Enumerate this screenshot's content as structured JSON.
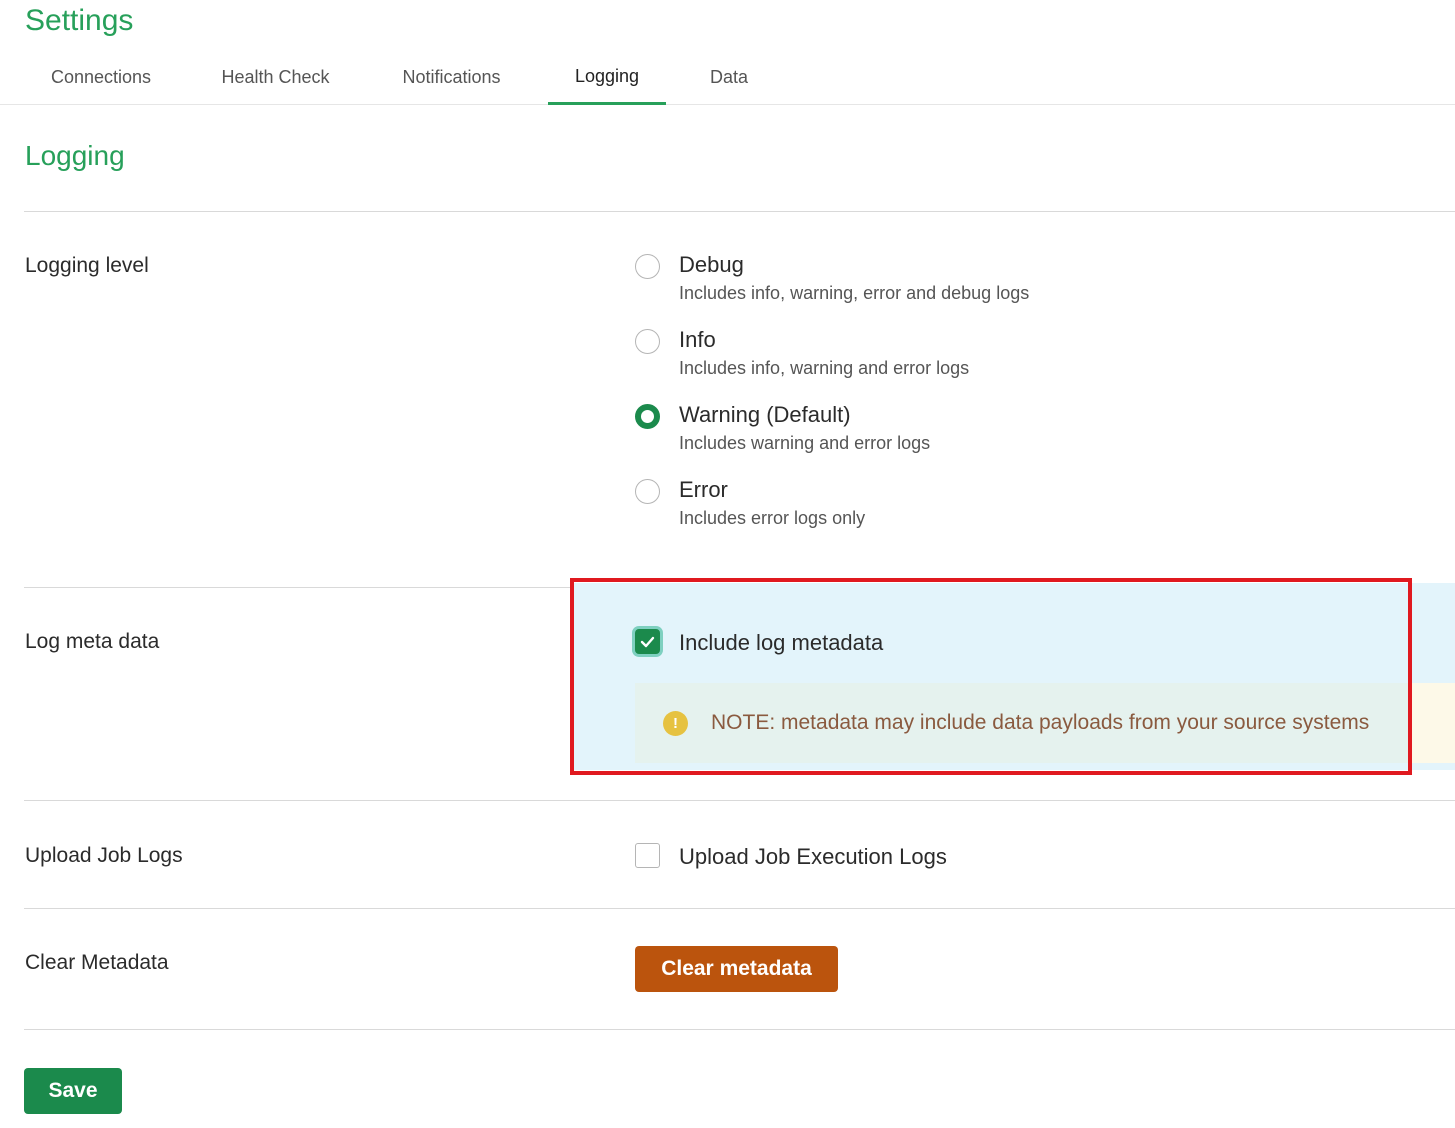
{
  "header": {
    "title": "Settings"
  },
  "tabs": [
    {
      "label": "Connections",
      "active": false
    },
    {
      "label": "Health Check",
      "active": false
    },
    {
      "label": "Notifications",
      "active": false
    },
    {
      "label": "Logging",
      "active": true
    },
    {
      "label": "Data",
      "active": false
    }
  ],
  "section": {
    "title": "Logging"
  },
  "logging_level": {
    "label": "Logging level",
    "selected": "Warning (Default)",
    "options": [
      {
        "title": "Debug",
        "description": "Includes info, warning, error and debug logs",
        "checked": false
      },
      {
        "title": "Info",
        "description": "Includes info, warning and error logs",
        "checked": false
      },
      {
        "title": "Warning (Default)",
        "description": "Includes warning and error logs",
        "checked": true
      },
      {
        "title": "Error",
        "description": "Includes error logs only",
        "checked": false
      }
    ]
  },
  "log_meta": {
    "label": "Log meta data",
    "checkbox_label": "Include log metadata",
    "checked": true,
    "note": "NOTE: metadata may include data payloads from your source systems",
    "note_icon": "!"
  },
  "upload_logs": {
    "label": "Upload Job Logs",
    "checkbox_label": "Upload Job Execution Logs",
    "checked": false
  },
  "clear_metadata": {
    "label": "Clear Metadata",
    "button_label": "Clear metadata"
  },
  "footer": {
    "save_label": "Save"
  },
  "colors": {
    "brand_green": "#27a05a",
    "primary_button": "#1b8a4c",
    "danger_button": "#bb540d",
    "highlight_border": "#e0191f",
    "note_icon": "#e6c240"
  }
}
